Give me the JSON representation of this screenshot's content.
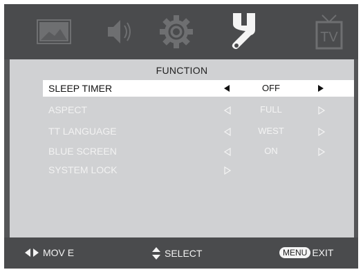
{
  "menu_title": "FUNCTION",
  "items": [
    {
      "label": "SLEEP   TIMER",
      "value": "OFF",
      "selected": true
    },
    {
      "label": "ASPECT",
      "value": "FULL"
    },
    {
      "label": "TT LANGUAGE",
      "value": "WEST"
    },
    {
      "label": "BLUE SCREEN",
      "value": "ON"
    },
    {
      "label": "SYSTEM LOCK",
      "value": ""
    }
  ],
  "tab_icons": [
    "picture-icon",
    "sound-icon",
    "gear-icon",
    "wrench-icon",
    "tv-icon"
  ],
  "tv_icon_text": "TV",
  "footer": {
    "move_label": "MOV E",
    "select_label": "SELECT",
    "menu_key": "MENU",
    "exit_label": "EXIT"
  },
  "colors": {
    "frame": "#555658",
    "bars": "#4a4b4d",
    "menu_bg": "#d0d1d3",
    "selected_bg": "#ffffff",
    "icon_dim": "#6d6e70",
    "icon_active": "#f4f4f4"
  }
}
